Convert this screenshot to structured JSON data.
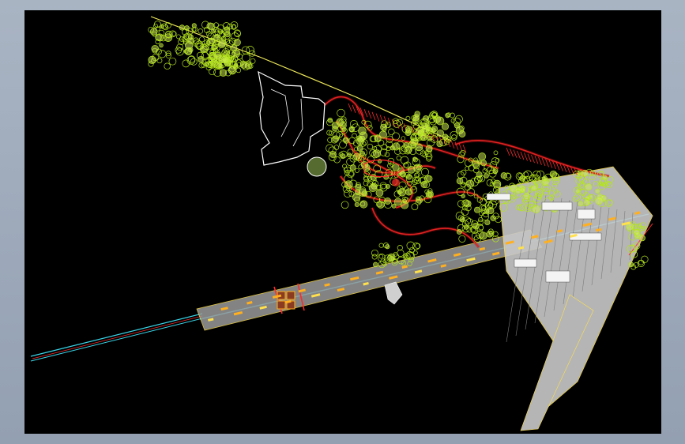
{
  "viewport": {
    "background": "#000000"
  },
  "drawing": {
    "colors": {
      "tree_outline": "#b5e61d",
      "tree_fill": "#d4f05a",
      "path_red": "#ff2a2a",
      "path_dark_red": "#b01010",
      "building_white": "#ffffff",
      "paving_gray": "#9a9a9a",
      "paving_light": "#c9c9c9",
      "accent_orange": "#ffb020",
      "accent_yellow": "#ffe14d",
      "axis_cyan": "#39d5e8",
      "boundary_yellow": "#f0ea5a"
    },
    "layers": [
      "tree-canopy",
      "circulation-paths",
      "existing-buildings",
      "plaza-paving",
      "promenade-axis",
      "planting-accents"
    ]
  }
}
